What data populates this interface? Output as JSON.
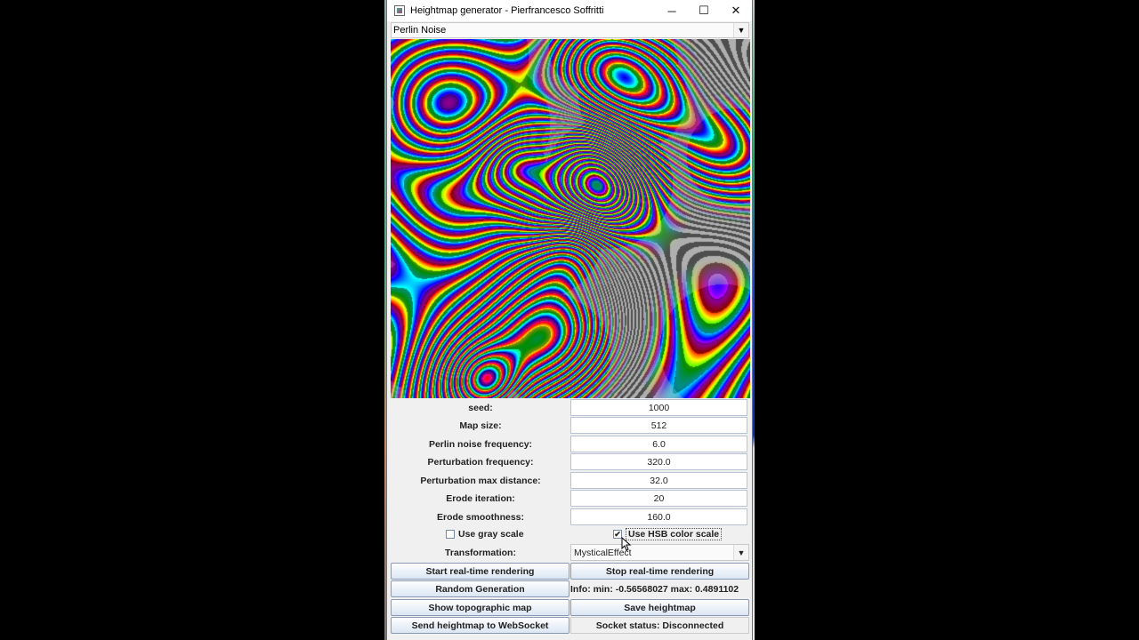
{
  "window": {
    "title": "Heightmap generator - Pierfrancesco Soffritti",
    "minimize_glyph": "─",
    "maximize_glyph": "☐",
    "close_glyph": "✕"
  },
  "noise_type": {
    "selected": "Perlin Noise"
  },
  "fields": [
    {
      "label": "seed:",
      "value": "1000"
    },
    {
      "label": "Map size:",
      "value": "512"
    },
    {
      "label": "Perlin noise frequency:",
      "value": "6.0"
    },
    {
      "label": "Perturbation frequency:",
      "value": "320.0"
    },
    {
      "label": "Perturbation max distance:",
      "value": "32.0"
    },
    {
      "label": "Erode iteration:",
      "value": "20"
    },
    {
      "label": "Erode smoothness:",
      "value": "160.0"
    }
  ],
  "options": {
    "gray_scale_label": "Use gray scale",
    "gray_scale_checked": false,
    "hsb_label": "Use HSB color scale",
    "hsb_checked": true
  },
  "transformation": {
    "label": "Transformation:",
    "selected": "MysticalEffect"
  },
  "buttons": {
    "start_rendering": "Start real-time rendering",
    "stop_rendering": "Stop real-time rendering",
    "random_generation": "Random Generation",
    "show_topographic": "Show topographic map",
    "save_heightmap": "Save heightmap",
    "send_websocket": "Send heightmap to WebSocket"
  },
  "info_text": "Info:  min: -0.56568027  max: 0.4891102",
  "socket_status": "Socket status: Disconnected"
}
